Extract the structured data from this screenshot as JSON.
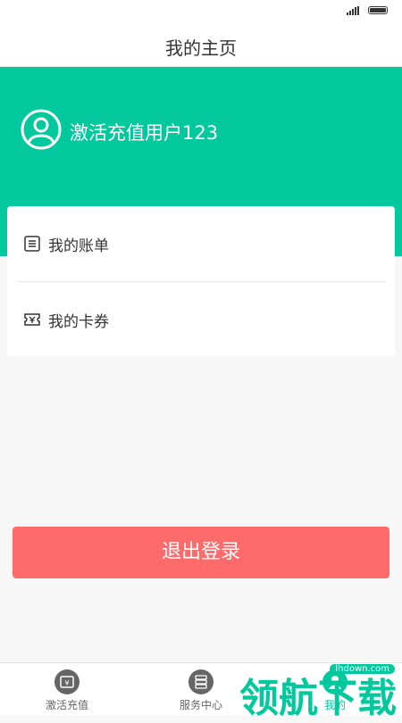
{
  "header": {
    "title": "我的主页"
  },
  "profile": {
    "username": "激活充值用户123",
    "avatar_icon": "user-avatar-icon"
  },
  "menu": {
    "items": [
      {
        "label": "我的账单",
        "icon": "bill-icon"
      },
      {
        "label": "我的卡券",
        "icon": "coupon-icon"
      }
    ]
  },
  "logout": {
    "label": "退出登录"
  },
  "tabbar": {
    "tabs": [
      {
        "label": "激活充值",
        "icon": "recharge-icon"
      },
      {
        "label": "服务中心",
        "icon": "service-icon"
      },
      {
        "label": "我的",
        "icon": "profile-icon"
      }
    ]
  },
  "watermark": {
    "text": "领航下载",
    "site": "lhdown.com"
  },
  "colors": {
    "accent": "#02c99d",
    "logout": "#ff6b6b"
  }
}
